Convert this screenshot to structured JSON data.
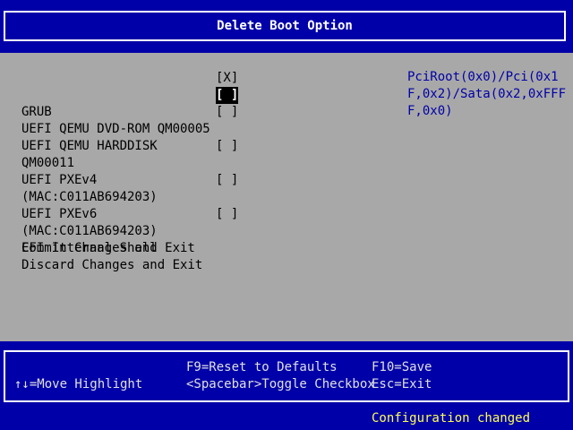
{
  "title": "Delete Boot Option",
  "boot_options": [
    {
      "label": "GRUB",
      "checkbox": "[X]"
    },
    {
      "label": "UEFI QEMU DVD-ROM QM00005",
      "checkbox": "[ ]"
    },
    {
      "label": "UEFI QEMU HARDDISK QM00011",
      "checkbox": "[ ]"
    },
    {
      "label": "UEFI PXEv4 (MAC:C011AB694203)",
      "checkbox": "[ ]"
    },
    {
      "label": "UEFI PXEv6 (MAC:C011AB694203)",
      "checkbox": "[ ]"
    },
    {
      "label": "EFI Internal Shell",
      "checkbox": "[ ]"
    }
  ],
  "actions": {
    "commit": "Commit Changes and Exit",
    "discard": "Discard Changes and Exit"
  },
  "help": "PciRoot(0x0)/Pci(0x1F,0x2)/Sata(0x2,0xFFFF,0x0)",
  "footer": {
    "move": "↑↓=Move Highlight",
    "reset": "F9=Reset to Defaults",
    "toggle": "<Spacebar>Toggle Checkbox",
    "save": "F10=Save",
    "exit": "Esc=Exit"
  },
  "status": "Configuration changed",
  "colors": {
    "background": "#0000a8",
    "panel": "#a8a8a8",
    "help_text": "#0000a8",
    "status_text": "#ffff55"
  }
}
